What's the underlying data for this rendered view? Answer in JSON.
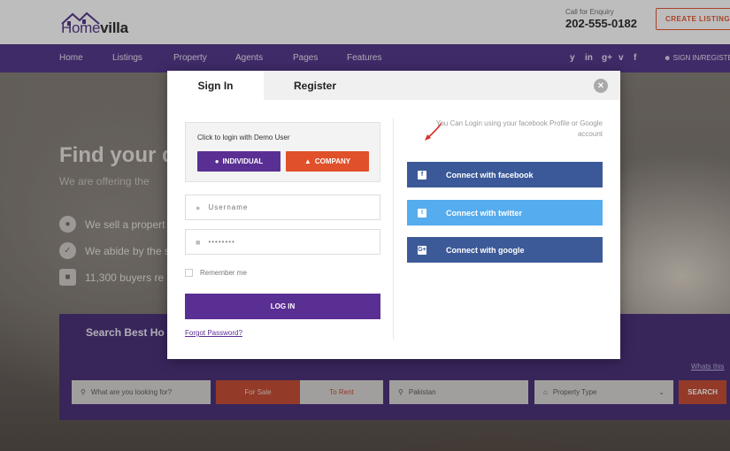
{
  "header": {
    "logo_part1": "Home",
    "logo_part2": "villa",
    "enquiry_label": "Call for Enquiry",
    "phone": "202-555-0182",
    "create_listing": "CREATE LISTING"
  },
  "nav": {
    "items": [
      "Home",
      "Listings",
      "Property",
      "Agents",
      "Pages",
      "Features"
    ],
    "social": [
      "y",
      "in",
      "g+",
      "v",
      "f"
    ],
    "signin": "SIGN IN/REGISTER"
  },
  "hero": {
    "title": "Find your d",
    "subtitle": "We are offering the",
    "features": [
      "We sell a propert",
      "We abide by the s",
      "11,300 buyers re"
    ]
  },
  "search": {
    "title": "Search Best Ho",
    "whats_this": "Whats this",
    "placeholder": "What are you looking for?",
    "for_sale": "For Sale",
    "to_rent": "To Rent",
    "location": "Pakistan",
    "property_type": "Property Type",
    "search_btn": "SEARCH"
  },
  "modal": {
    "tab_signin": "Sign In",
    "tab_register": "Register",
    "close": "×",
    "demo_label": "Click to login with Demo User",
    "btn_individual": "INDIVIDUAL",
    "btn_company": "COMPANY",
    "username_placeholder": "Username",
    "password_value": "••••••••",
    "remember": "Remember me",
    "login": "LOG IN",
    "forgot": "Forgot Password?",
    "social_note": "You Can Login using your facebook Profile or Google account",
    "facebook": "Connect with facebook",
    "twitter": "Connect with twitter",
    "google": "Connect with google"
  },
  "colors": {
    "brand_purple": "#4a2e86",
    "button_purple": "#5a2f93",
    "accent_orange": "#e0502a",
    "facebook": "#3b5998",
    "twitter": "#55acee"
  }
}
